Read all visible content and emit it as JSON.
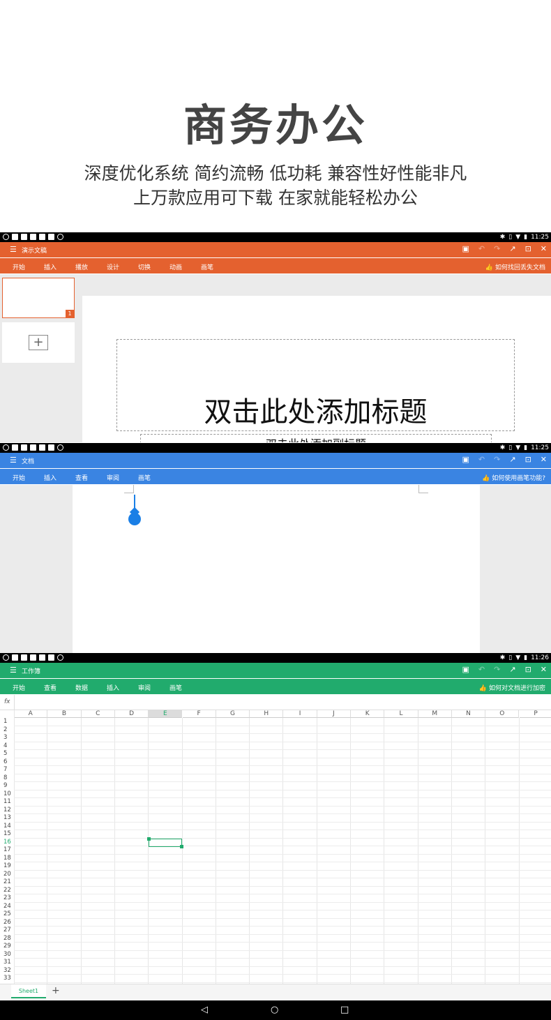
{
  "promo": {
    "title": "商务办公",
    "line1": "深度优化系统 简约流畅 低功耗 兼容性好性能非凡",
    "line2": "上万款应用可下载 在家就能轻松办公"
  },
  "status": {
    "time1": "11:25",
    "time2": "11:25",
    "time3": "11:26"
  },
  "presentation": {
    "title": "演示文稿",
    "tabs": [
      "开始",
      "插入",
      "播放",
      "设计",
      "切换",
      "动画",
      "画笔"
    ],
    "help": "如何找回丢失文档",
    "slide_number": "1",
    "slide_title": "双击此处添加标题",
    "slide_subtitle": "双击此处添加副标题"
  },
  "document": {
    "title": "文档",
    "tabs": [
      "开始",
      "插入",
      "查看",
      "审阅",
      "画笔"
    ],
    "help": "如何使用画笔功能?"
  },
  "spreadsheet": {
    "title": "工作簿",
    "tabs": [
      "开始",
      "查看",
      "数据",
      "插入",
      "审阅",
      "画笔"
    ],
    "help": "如何对文档进行加密",
    "fx": "fx",
    "columns": [
      "A",
      "B",
      "C",
      "D",
      "E",
      "F",
      "G",
      "H",
      "I",
      "J",
      "K",
      "L",
      "M",
      "N",
      "O",
      "P"
    ],
    "active_column": "E",
    "rows": [
      "1",
      "2",
      "3",
      "4",
      "5",
      "6",
      "7",
      "8",
      "9",
      "10",
      "11",
      "12",
      "13",
      "14",
      "15",
      "16",
      "17",
      "18",
      "19",
      "20",
      "21",
      "22",
      "23",
      "24",
      "25",
      "26",
      "27",
      "28",
      "29",
      "30",
      "31",
      "32",
      "33"
    ],
    "active_row": "16",
    "sheet_tab": "Sheet1",
    "add_sheet": "+"
  },
  "accent_colors": {
    "presentation": "#e4612f",
    "document": "#3a84e2",
    "spreadsheet": "#21ab6d"
  }
}
